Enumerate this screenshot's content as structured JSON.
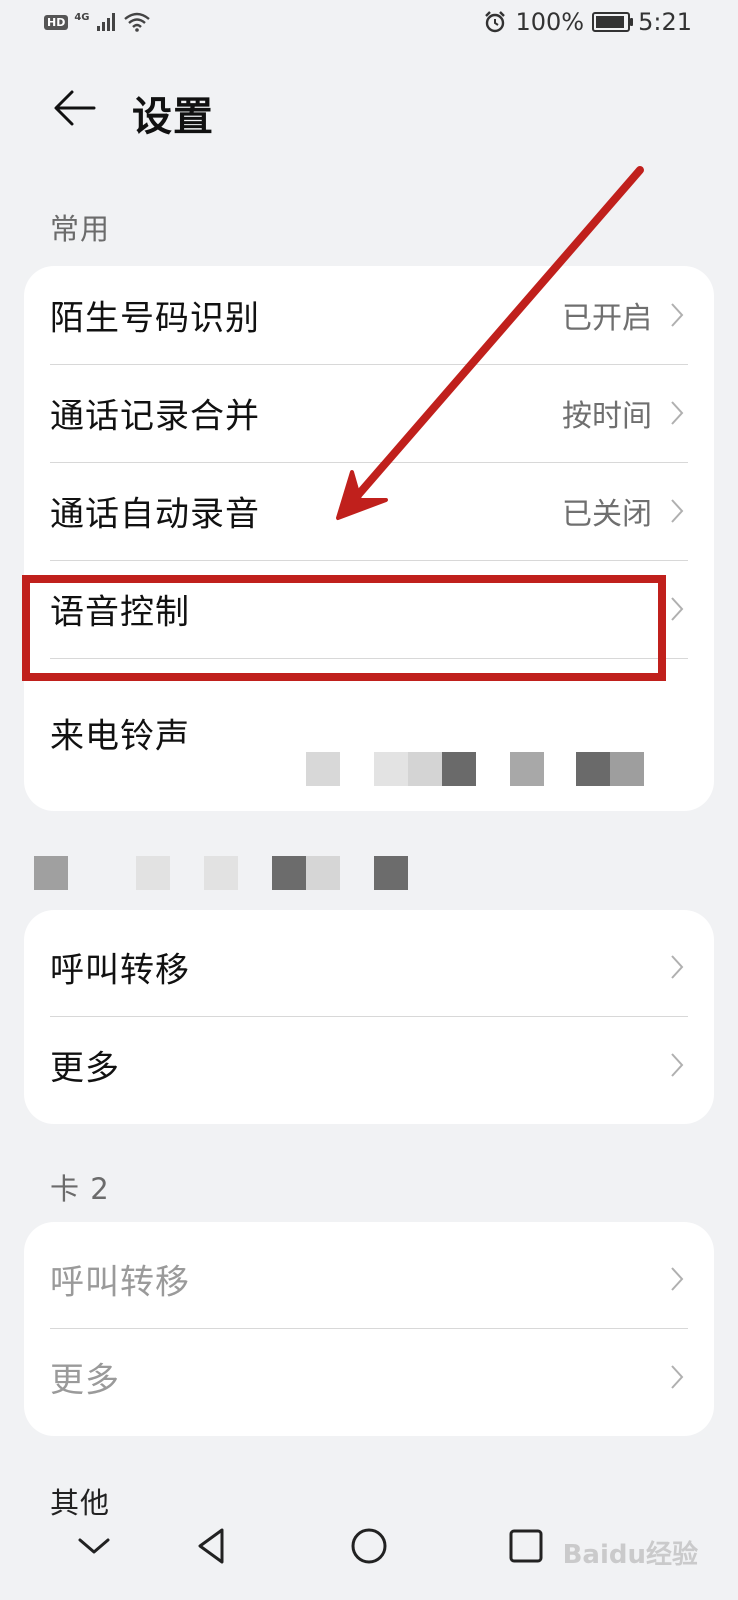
{
  "status_bar": {
    "hd": "HD",
    "network": "4G",
    "battery": "100%",
    "time": "5:21",
    "battery_level": 1.0
  },
  "header": {
    "title": "设置"
  },
  "sections": {
    "common_label": "常用",
    "card2_label": "卡 2",
    "other_label": "其他"
  },
  "common_items": [
    {
      "label": "陌生号码识别",
      "value": "已开启"
    },
    {
      "label": "通话记录合并",
      "value": "按时间"
    },
    {
      "label": "通话自动录音",
      "value": "已关闭"
    },
    {
      "label": "语音控制",
      "value": ""
    },
    {
      "label": "来电铃声",
      "value": ""
    }
  ],
  "card1_items": [
    {
      "label": "呼叫转移"
    },
    {
      "label": "更多"
    }
  ],
  "card2_items": [
    {
      "label": "呼叫转移"
    },
    {
      "label": "更多"
    }
  ],
  "watermark": "Baidu经验",
  "colors": {
    "annotation_red": "#c0201c",
    "background": "#f1f2f4",
    "card": "#ffffff"
  }
}
